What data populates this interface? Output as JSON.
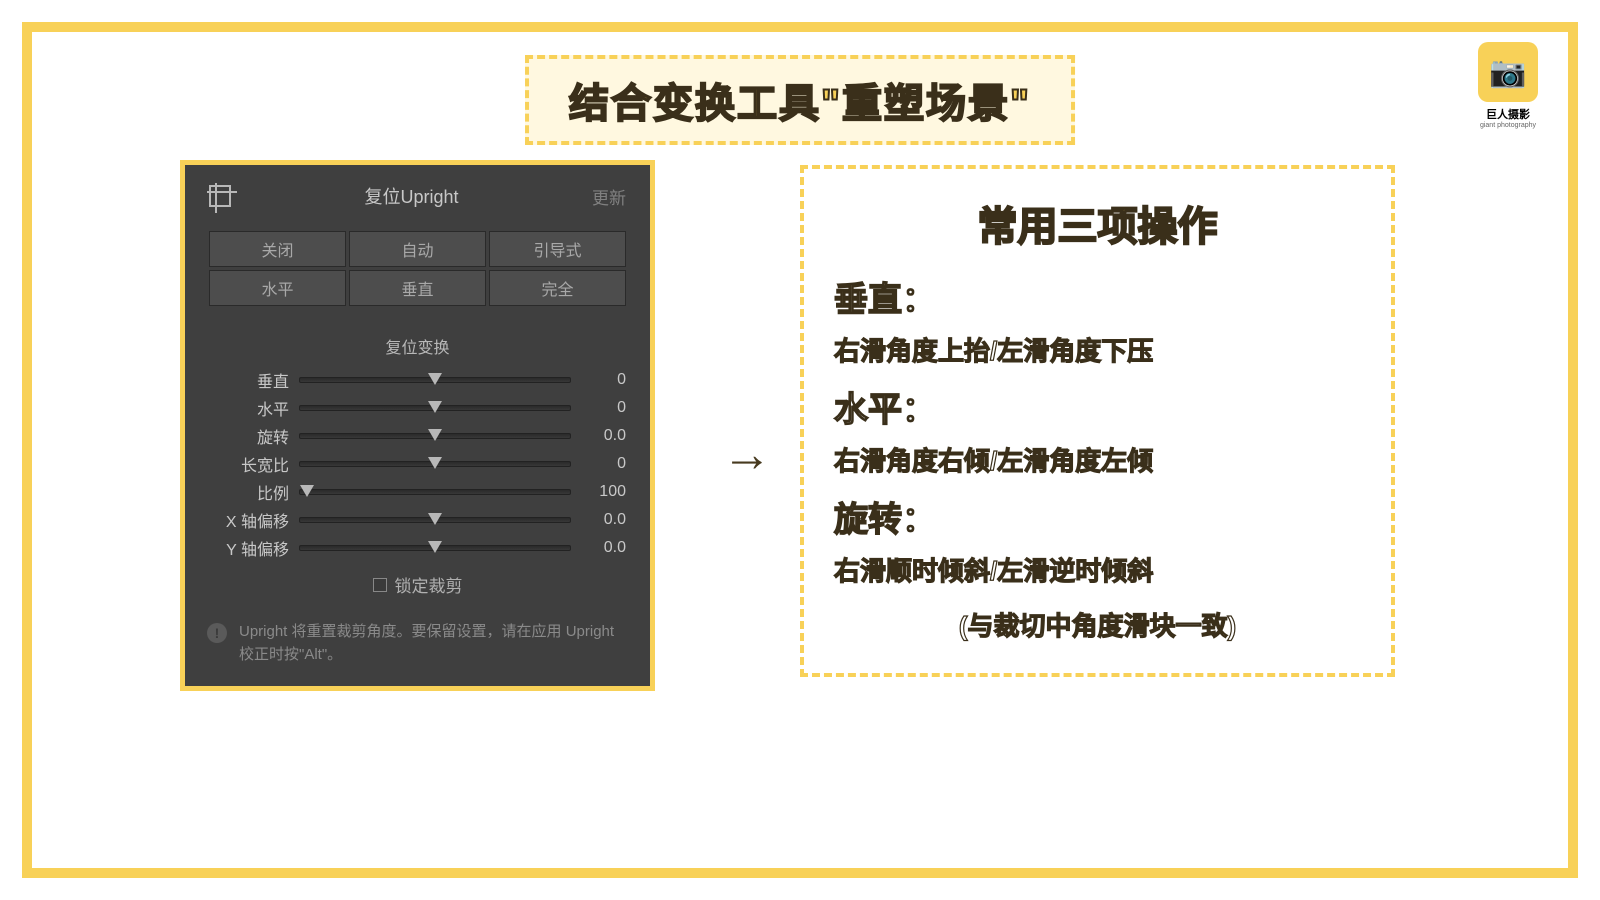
{
  "logo": {
    "brand": "巨人摄影",
    "sub": "giant photography"
  },
  "title": "结合变换工具\"重塑场景\"",
  "panel": {
    "title": "复位Upright",
    "update": "更新",
    "modes": [
      "关闭",
      "自动",
      "引导式",
      "水平",
      "垂直",
      "完全"
    ],
    "section_label": "复位变换",
    "sliders": [
      {
        "label": "垂直",
        "value": "0",
        "pos": "center"
      },
      {
        "label": "水平",
        "value": "0",
        "pos": "center"
      },
      {
        "label": "旋转",
        "value": "0.0",
        "pos": "center"
      },
      {
        "label": "长宽比",
        "value": "0",
        "pos": "center"
      },
      {
        "label": "比例",
        "value": "100",
        "pos": "left"
      },
      {
        "label": "X 轴偏移",
        "value": "0.0",
        "pos": "center"
      },
      {
        "label": "Y 轴偏移",
        "value": "0.0",
        "pos": "center"
      }
    ],
    "lock_label": "锁定裁剪",
    "warning": "Upright 将重置裁剪角度。要保留设置，请在应用 Upright 校正时按\"Alt\"。"
  },
  "arrow": "→",
  "instructions": {
    "title": "常用三项操作",
    "items": [
      {
        "heading": "垂直：",
        "body": "右滑角度上抬/左滑角度下压"
      },
      {
        "heading": "水平：",
        "body": "右滑角度右倾/左滑角度左倾"
      },
      {
        "heading": "旋转：",
        "body": "右滑顺时倾斜/左滑逆时倾斜"
      }
    ],
    "note": "(与裁切中角度滑块一致)"
  }
}
